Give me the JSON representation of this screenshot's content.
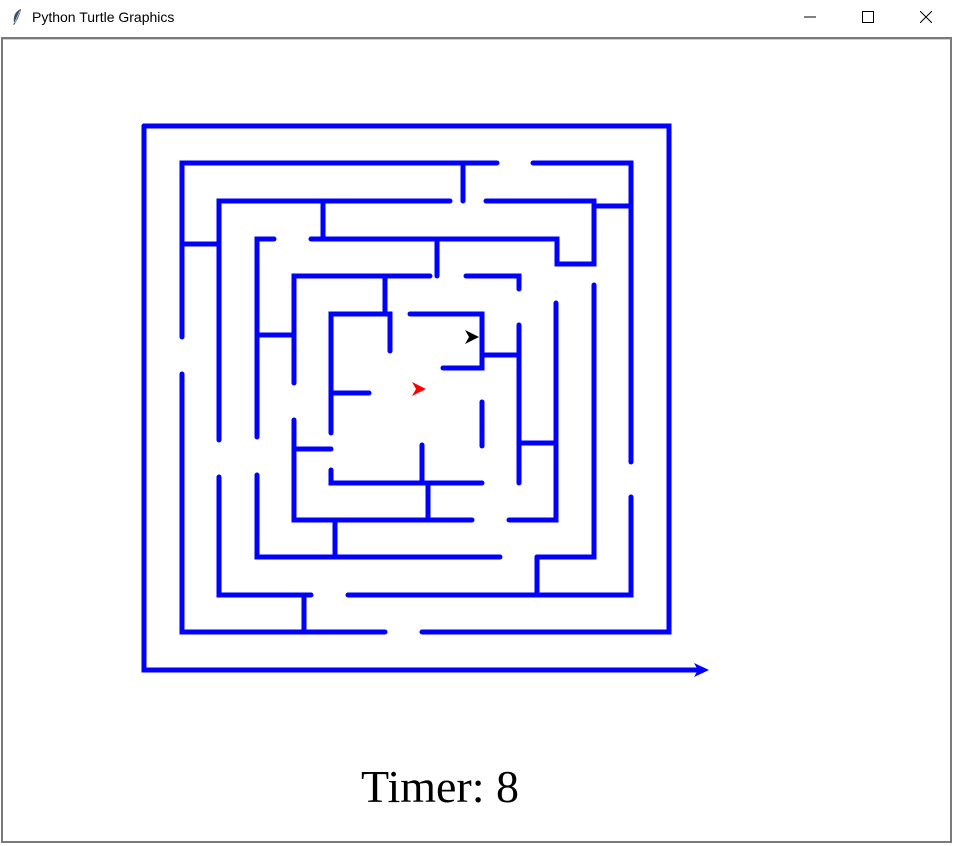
{
  "window": {
    "title": "Python Turtle Graphics",
    "app_icon": "feather-icon",
    "controls": [
      "minimize-icon",
      "maximize-icon",
      "close-icon"
    ]
  },
  "game": {
    "timer_label": "Timer: 8",
    "maze_color": "#0000ff",
    "player_color": "#ff0000",
    "goal_color": "#000000"
  }
}
